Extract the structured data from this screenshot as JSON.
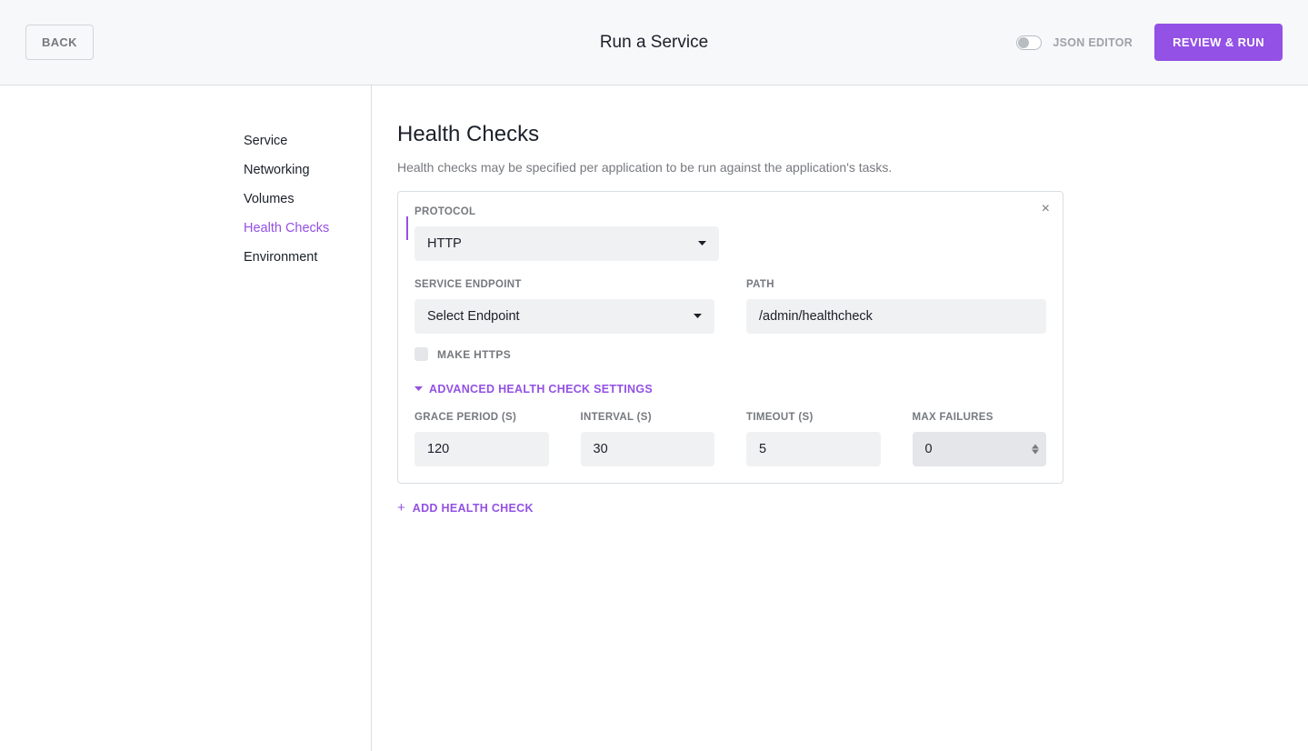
{
  "header": {
    "back_label": "BACK",
    "title": "Run a Service",
    "json_editor_label": "JSON EDITOR",
    "review_label": "REVIEW & RUN"
  },
  "sidebar": {
    "items": [
      {
        "label": "Service"
      },
      {
        "label": "Networking"
      },
      {
        "label": "Volumes"
      },
      {
        "label": "Health Checks"
      },
      {
        "label": "Environment"
      }
    ]
  },
  "main": {
    "title": "Health Checks",
    "description": "Health checks may be specified per application to be run against the application's tasks.",
    "add_health_check_label": "ADD HEALTH CHECK"
  },
  "form": {
    "protocol_label": "PROTOCOL",
    "protocol_value": "HTTP",
    "endpoint_label": "SERVICE ENDPOINT",
    "endpoint_value": "Select Endpoint",
    "path_label": "PATH",
    "path_value": "/admin/healthcheck",
    "make_https_label": "MAKE HTTPS",
    "advanced_label": "ADVANCED HEALTH CHECK SETTINGS",
    "grace_label": "GRACE PERIOD (S)",
    "grace_value": "120",
    "interval_label": "INTERVAL (S)",
    "interval_value": "30",
    "timeout_label": "TIMEOUT (S)",
    "timeout_value": "5",
    "max_failures_label": "MAX FAILURES",
    "max_failures_value": "0"
  }
}
